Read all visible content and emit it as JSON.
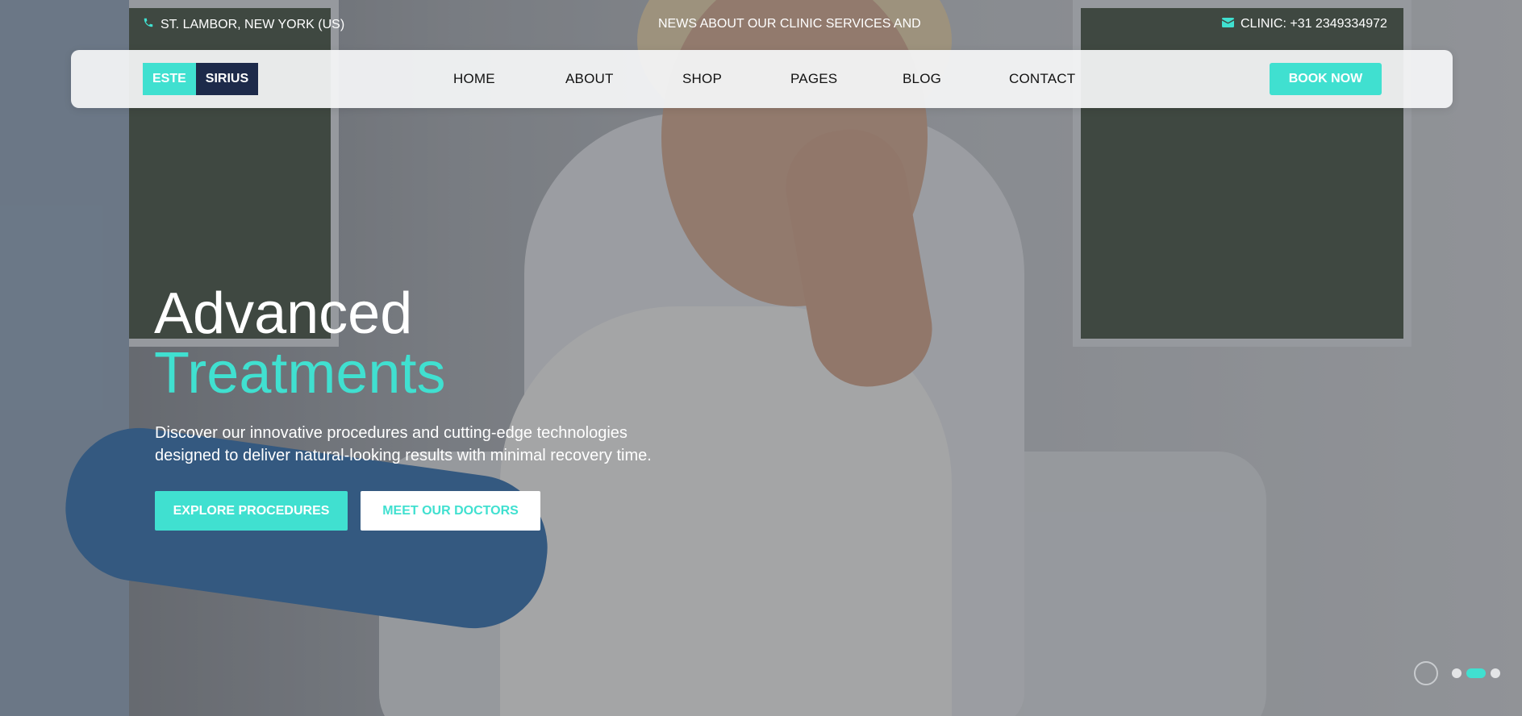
{
  "colors": {
    "accent": "#40e0d0",
    "navy": "#1d2a4a",
    "white": "#ffffff",
    "text_dark": "#111111"
  },
  "topbar": {
    "address": "ST. LAMBOR, NEW YORK (US)",
    "news": "NEWS ABOUT OUR CLINIC SERVICES AND",
    "phone": "CLINIC: +31 2349334972",
    "address_icon": "phone-icon",
    "phone_icon": "mail-icon"
  },
  "logo": {
    "part1": "ESTE",
    "part2": "SIRIUS"
  },
  "nav": {
    "items": [
      {
        "label": "HOME"
      },
      {
        "label": "ABOUT"
      },
      {
        "label": "SHOP"
      },
      {
        "label": "PAGES"
      },
      {
        "label": "BLOG"
      },
      {
        "label": "CONTACT"
      }
    ],
    "book_label": "BOOK NOW"
  },
  "hero": {
    "title_line1": "Advanced",
    "title_line2": "Treatments",
    "description": "Discover our innovative procedures and cutting-edge technologies designed to deliver natural-looking results with minimal recovery time.",
    "primary_button": "EXPLORE PROCEDURES",
    "secondary_button": "MEET OUR DOCTORS"
  },
  "slider": {
    "slide_count": 3,
    "active_index": 1
  }
}
